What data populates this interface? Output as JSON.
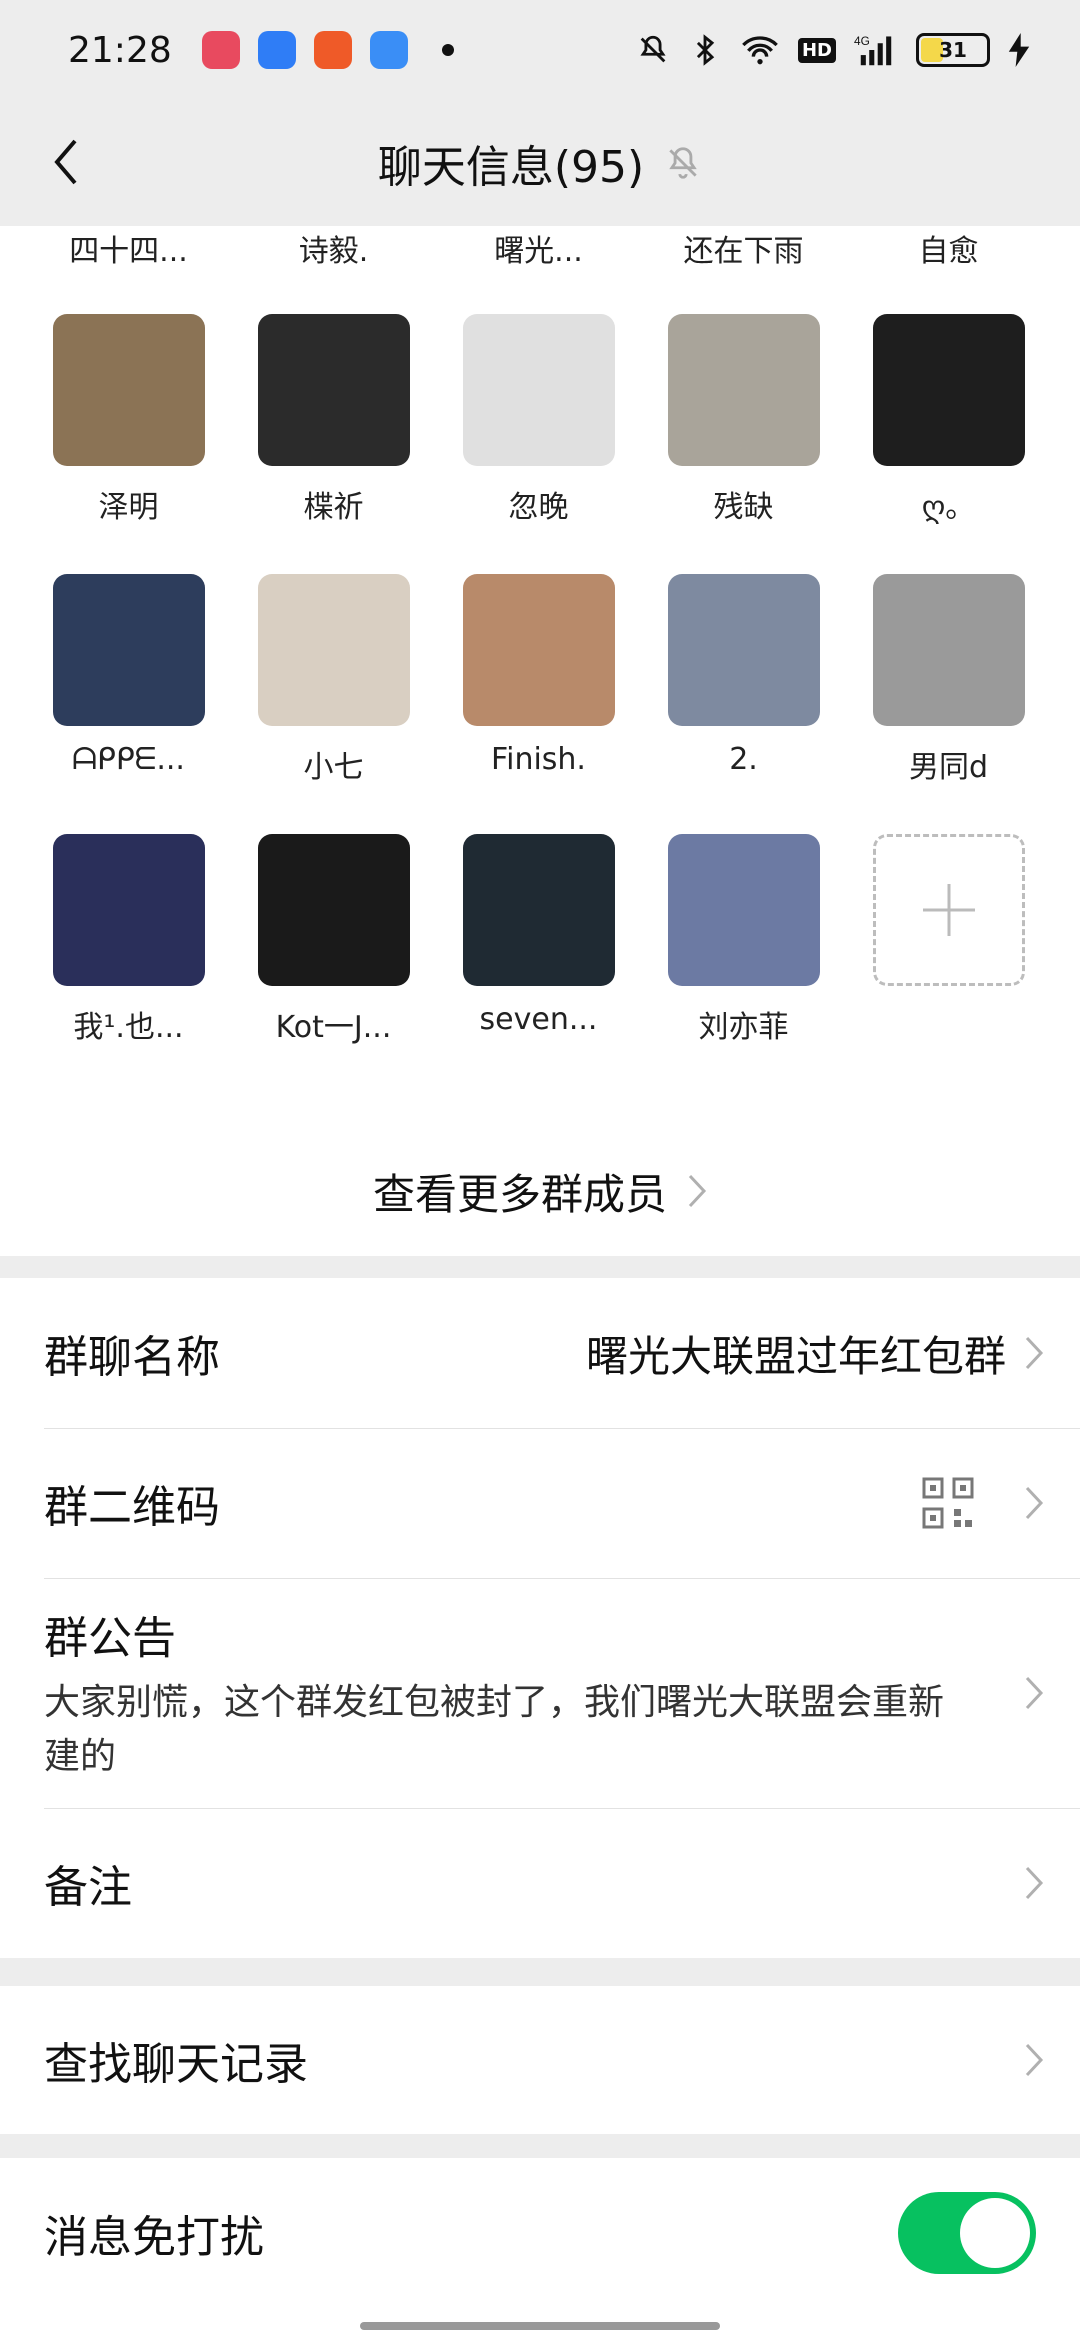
{
  "status_bar": {
    "time": "21:28",
    "battery": "31",
    "hd_label": "HD",
    "network": "4G"
  },
  "header": {
    "title": "聊天信息(95)"
  },
  "members_partial_row": [
    "四十四...",
    "诗毅.",
    "曙光...",
    "还在下雨",
    "自愈"
  ],
  "members": [
    {
      "name": "泽明",
      "color": "#8b7355"
    },
    {
      "name": "楪祈",
      "color": "#2b2b2b"
    },
    {
      "name": "忽晚",
      "color": "#e0e0e0"
    },
    {
      "name": "残缺",
      "color": "#a9a49a"
    },
    {
      "name": "ღ。",
      "color": "#1e1e1e"
    },
    {
      "name": "ᗩᑭᑭᗴ...",
      "color": "#2d3d5c"
    },
    {
      "name": "小七",
      "color": "#d9cfc2"
    },
    {
      "name": "Finish.",
      "color": "#b88a6a"
    },
    {
      "name": "2.",
      "color": "#7e8aa0"
    },
    {
      "name": "男同d",
      "color": "#9a9a9a"
    },
    {
      "name": "我¹.也...",
      "color": "#2a2f5a"
    },
    {
      "name": "Kot一J...",
      "color": "#1a1a1a"
    },
    {
      "name": "seven...",
      "color": "#1f2a33"
    },
    {
      "name": "刘亦菲",
      "color": "#6c7aa3"
    }
  ],
  "more_members": "查看更多群成员",
  "group_info": {
    "name_label": "群聊名称",
    "name_value": "曙光大联盟过年红包群",
    "qr_label": "群二维码",
    "notice_label": "群公告",
    "notice_text": "大家别慌，这个群发红包被封了，我们曙光大联盟会重新建的",
    "remark_label": "备注"
  },
  "search": {
    "label": "查找聊天记录"
  },
  "mute": {
    "label": "消息免打扰",
    "enabled": true
  },
  "colors": {
    "accent": "#07c160",
    "background": "#ededed"
  }
}
